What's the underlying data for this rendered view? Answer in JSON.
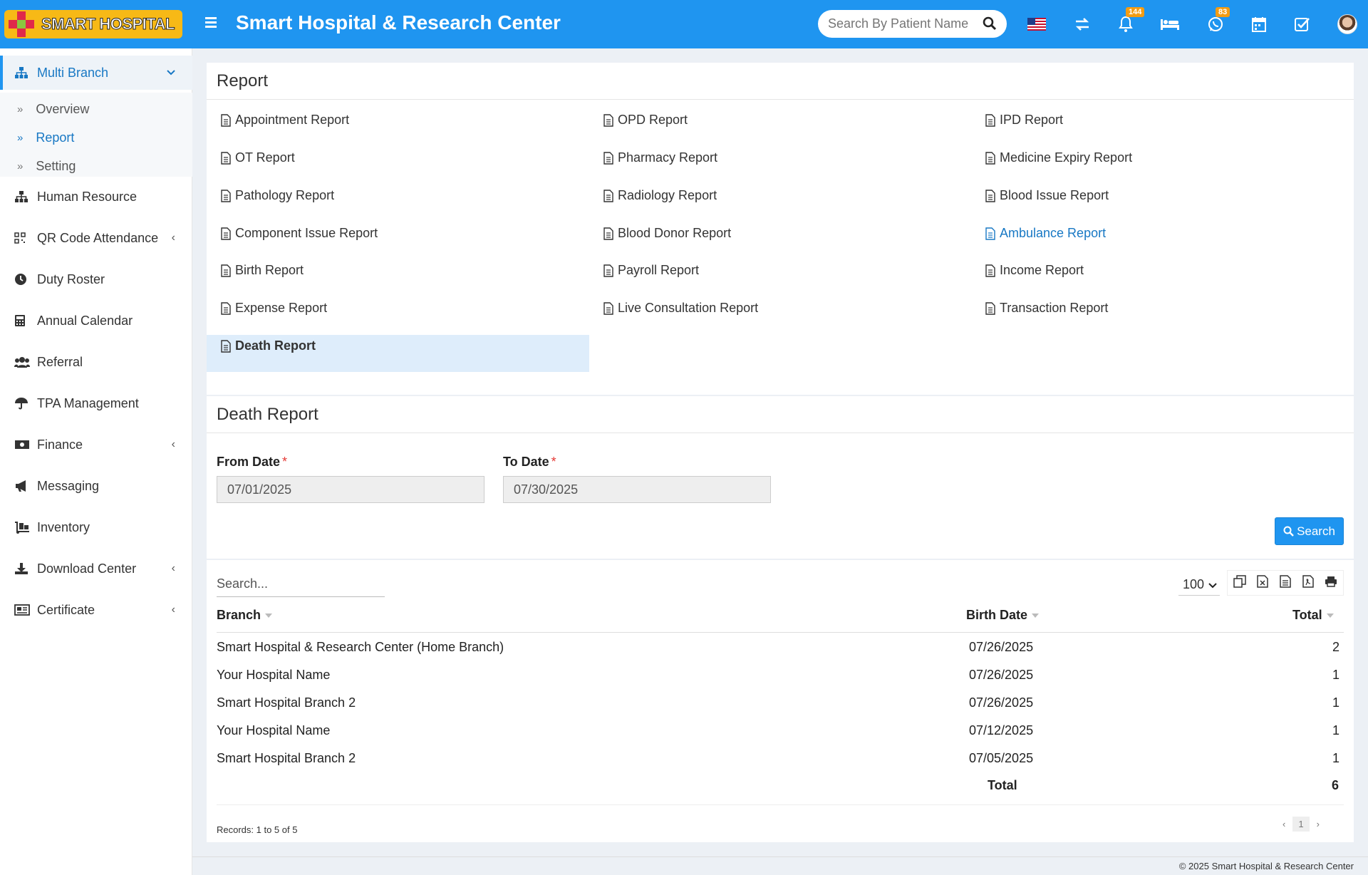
{
  "header": {
    "logo_text": "SMART HOSPITAL",
    "title": "Smart Hospital & Research Center",
    "search_placeholder": "Search By Patient Name",
    "notification_count": "144",
    "whatsapp_count": "83"
  },
  "sidebar": {
    "items": [
      {
        "label": "Multi Branch",
        "icon": "sitemap-icon"
      },
      {
        "label": "Human Resource",
        "icon": "sitemap-icon"
      },
      {
        "label": "QR Code Attendance",
        "icon": "qrcode-icon"
      },
      {
        "label": "Duty Roster",
        "icon": "clock-icon"
      },
      {
        "label": "Annual Calendar",
        "icon": "calculator-icon"
      },
      {
        "label": "Referral",
        "icon": "users-icon"
      },
      {
        "label": "TPA Management",
        "icon": "umbrella-icon"
      },
      {
        "label": "Finance",
        "icon": "money-icon"
      },
      {
        "label": "Messaging",
        "icon": "bullhorn-icon"
      },
      {
        "label": "Inventory",
        "icon": "dolly-icon"
      },
      {
        "label": "Download Center",
        "icon": "download-icon"
      },
      {
        "label": "Certificate",
        "icon": "newspaper-icon"
      }
    ],
    "submenu": [
      {
        "label": "Overview"
      },
      {
        "label": "Report"
      },
      {
        "label": "Setting"
      }
    ]
  },
  "report_panel": {
    "title": "Report",
    "links": [
      "Appointment Report",
      "OPD Report",
      "IPD Report",
      "OT Report",
      "Pharmacy Report",
      "Medicine Expiry Report",
      "Pathology Report",
      "Radiology Report",
      "Blood Issue Report",
      "Component Issue Report",
      "Blood Donor Report",
      "Ambulance Report",
      "Birth Report",
      "Payroll Report",
      "Income Report",
      "Expense Report",
      "Live Consultation Report",
      "Transaction Report",
      "Death Report"
    ]
  },
  "death_panel": {
    "title": "Death Report",
    "from_label": "From Date",
    "to_label": "To Date",
    "required_mark": "*",
    "from_value": "07/01/2025",
    "to_value": "07/30/2025",
    "search_button": "Search"
  },
  "table": {
    "search_placeholder": "Search...",
    "per_page": "100",
    "headers": {
      "branch": "Branch",
      "birth_date": "Birth Date",
      "total": "Total"
    },
    "rows": [
      {
        "branch": "Smart Hospital & Research Center (Home Branch)",
        "date": "07/26/2025",
        "total": "2"
      },
      {
        "branch": "Your Hospital Name",
        "date": "07/26/2025",
        "total": "1"
      },
      {
        "branch": "Smart Hospital Branch 2",
        "date": "07/26/2025",
        "total": "1"
      },
      {
        "branch": "Your Hospital Name",
        "date": "07/12/2025",
        "total": "1"
      },
      {
        "branch": "Smart Hospital Branch 2",
        "date": "07/05/2025",
        "total": "1"
      }
    ],
    "footer_label": "Total",
    "footer_total": "6",
    "records": "Records: 1 to 5 of 5",
    "page": "1",
    "prev": "‹",
    "next": "›"
  },
  "footer": {
    "text": "© 2025 Smart Hospital & Research Center"
  }
}
